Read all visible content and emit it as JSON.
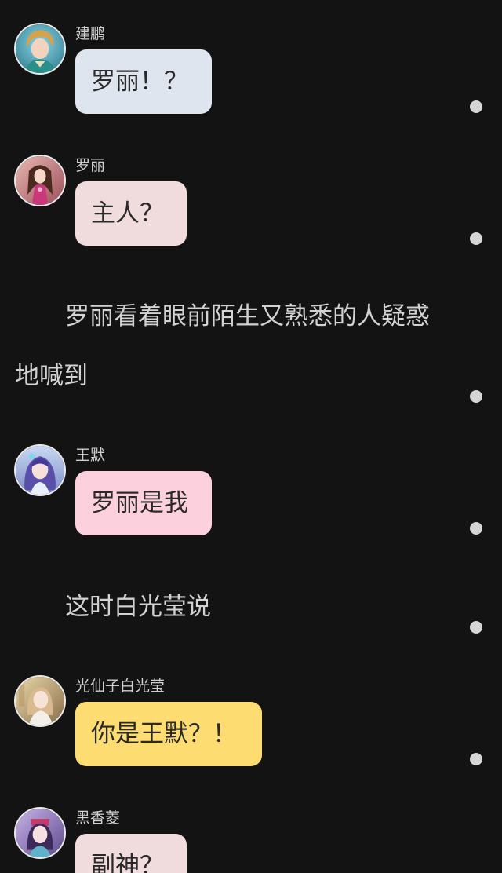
{
  "messages": [
    {
      "name": "建鹏",
      "text": "罗丽！？",
      "bubble_color": "#dfe5ef"
    },
    {
      "name": "罗丽",
      "text": "主人？",
      "bubble_color": "#f0dcdd"
    },
    {
      "name": "王默",
      "text": "罗丽是我",
      "bubble_color": "#fcd0dc"
    },
    {
      "name": "光仙子白光莹",
      "text": "你是王默？！",
      "bubble_color": "#fddd72"
    },
    {
      "name": "黑香菱",
      "text": "副神？",
      "bubble_color": "#f0dcdd"
    }
  ],
  "narrations": [
    {
      "line1": "罗丽看着眼前陌生又熟悉的人疑惑",
      "line2": "地喊到"
    },
    {
      "line1": "这时白光莹说"
    }
  ],
  "colors": {
    "background": "#131313",
    "dot": "#d6d6d6"
  },
  "icons": {
    "avatar": "character-avatar-icon",
    "dot": "more-dot-icon"
  }
}
